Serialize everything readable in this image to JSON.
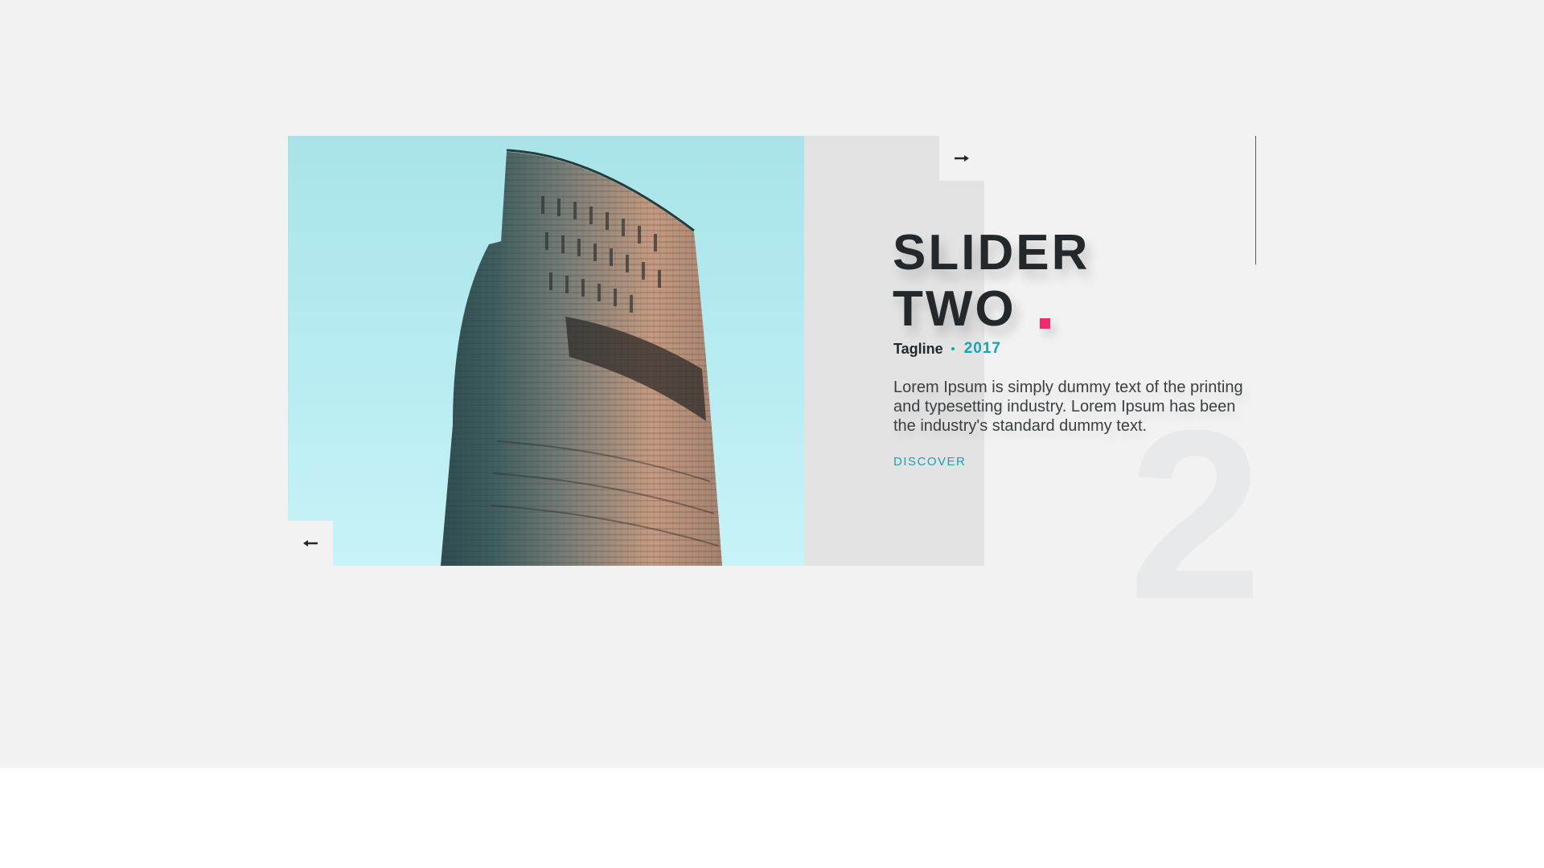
{
  "slide": {
    "title_line1": "SLIDER",
    "title_line2": "TWO",
    "tagline": "Tagline",
    "year": "2017",
    "description": "Lorem Ipsum is simply dummy text of the printing and typesetting industry. Lorem Ipsum has been the industry's standard dummy text.",
    "cta_label": "DISCOVER",
    "slide_number": "2"
  },
  "navigation": {
    "next_icon": "arrow-right-icon",
    "prev_icon": "arrow-left-icon"
  },
  "colors": {
    "accent": "#16a3b2",
    "highlight": "#ee2c6c",
    "title": "#23282c",
    "background": "#f1f2f1",
    "panel": "#e3e3e3"
  }
}
